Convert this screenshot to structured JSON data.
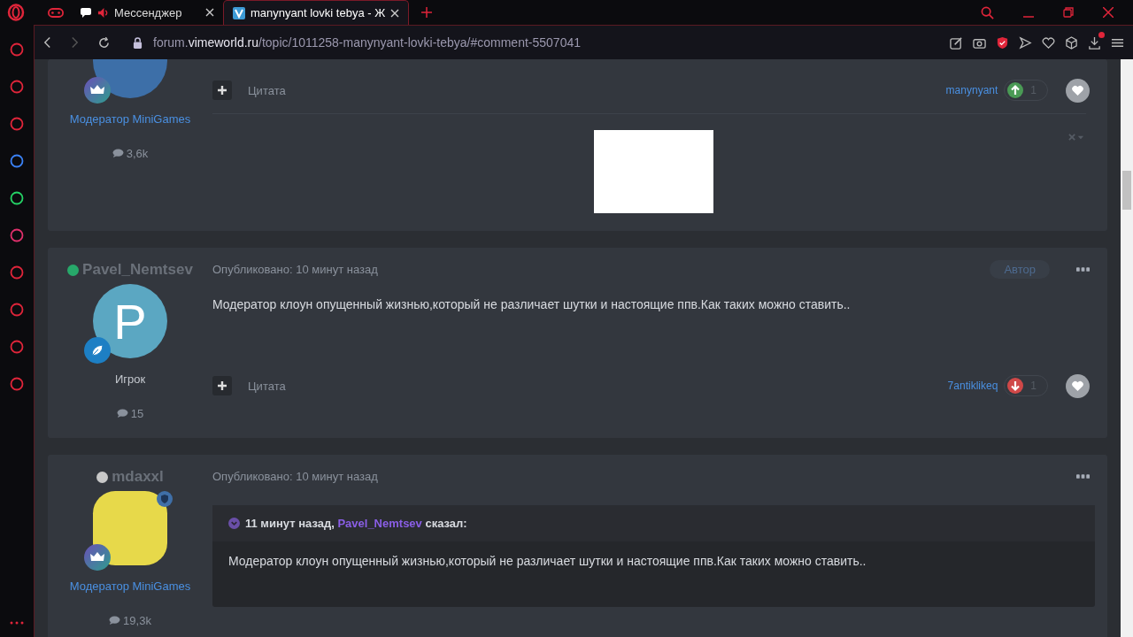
{
  "browser": {
    "tabs": [
      {
        "kind": "icon",
        "selected": false
      },
      {
        "kind": "page",
        "label": "Мессенджер",
        "muted": false,
        "selected": false
      },
      {
        "kind": "page",
        "label": "manynyant lovki tebya - Ж",
        "selected": true
      }
    ],
    "address": {
      "host_prefix": "forum.",
      "host": "vimeworld.ru",
      "path": "/topic/1011258-manynyant-lovki-tebya/#comment-5507041"
    },
    "downloads_badge": true
  },
  "posts": [
    {
      "avatar": {
        "kind": "photo"
      },
      "rank": {
        "kind": "crown"
      },
      "role": {
        "kind": "staff",
        "text": "Модератор MiniGames"
      },
      "posts_count": "3,6k",
      "quote_label": "Цитата",
      "reaction": {
        "user": "manynyant",
        "kind": "up",
        "count": "1"
      },
      "image": true
    },
    {
      "author": "Pavel_Nemtsev",
      "online": true,
      "published": "Опубликовано: 10 минут назад",
      "author_badge": "Автор",
      "avatar": {
        "kind": "letter",
        "letter": "P"
      },
      "rank": {
        "kind": "leaf"
      },
      "body": "Модератор клоун опущенный жизнью,который не различает шутки и настоящие ппв.Как таких можно ставить..",
      "role": {
        "kind": "member",
        "text": "Игрок"
      },
      "posts_count": "15",
      "quote_label": "Цитата",
      "reaction": {
        "user": "7antiklikeq",
        "kind": "down",
        "count": "1"
      }
    },
    {
      "author": "mdaxxl",
      "online": false,
      "published": "Опубликовано: 10 минут назад",
      "avatar": {
        "kind": "cartoon"
      },
      "rank": {
        "kind": "crown"
      },
      "role": {
        "kind": "staff",
        "text": "Модератор MiniGames"
      },
      "posts_count": "19,3k",
      "quote": {
        "before": "11 минут назад,",
        "user": "Pavel_Nemtsev",
        "after": "сказал:",
        "text": "Модератор клоун опущенный жизнью,который не различает шутки и настоящие ппв.Как таких можно ставить.."
      }
    }
  ]
}
